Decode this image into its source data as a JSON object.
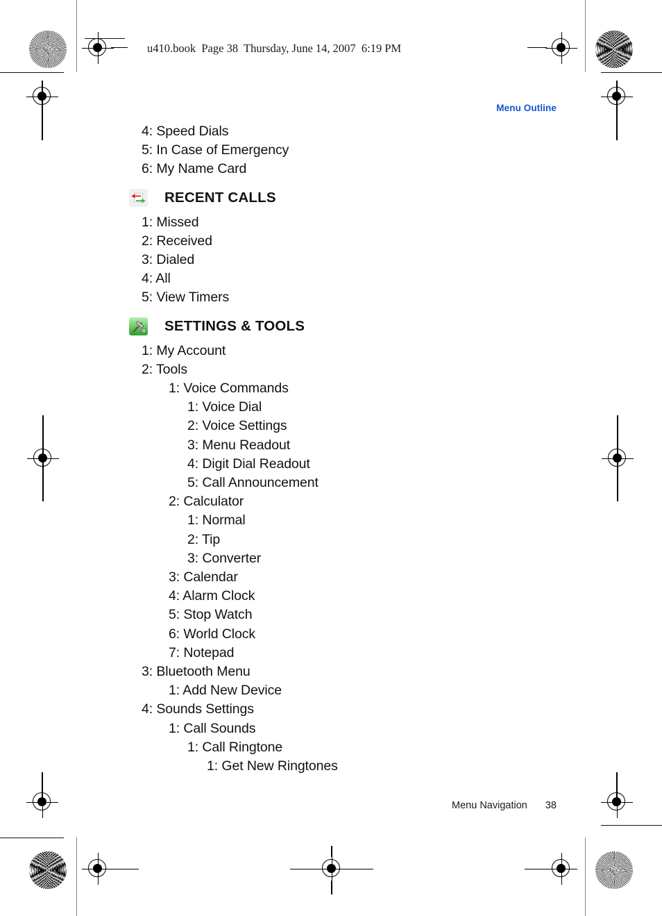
{
  "document": {
    "header_line": "u410.book  Page 38  Thursday, June 14, 2007  6:19 PM",
    "running_head": "Menu Outline",
    "running_head_color": "#1455d0",
    "footer_label": "Menu Navigation",
    "footer_page_number": "38"
  },
  "continued_items": [
    {
      "level": 1,
      "text": "4: Speed Dials"
    },
    {
      "level": 1,
      "text": "5: In Case of Emergency"
    },
    {
      "level": 1,
      "text": "6: My Name Card"
    }
  ],
  "sections": [
    {
      "title": "RECENT CALLS",
      "icon": "recent-calls-icon",
      "icon_colors": {
        "incoming_arrow": "#e02020",
        "outgoing_arrow": "#2eb82e",
        "background": "#e8ecef"
      },
      "items": [
        {
          "level": 1,
          "text": "1: Missed"
        },
        {
          "level": 1,
          "text": "2: Received"
        },
        {
          "level": 1,
          "text": "3: Dialed"
        },
        {
          "level": 1,
          "text": "4: All"
        },
        {
          "level": 1,
          "text": "5: View Timers"
        }
      ]
    },
    {
      "title": "SETTINGS & TOOLS",
      "icon": "settings-tools-icon",
      "icon_colors": {
        "background_top": "#8fe08a",
        "background_bottom": "#2f9e2a",
        "tool": "#4a4033"
      },
      "items": [
        {
          "level": 1,
          "text": "1: My Account"
        },
        {
          "level": 1,
          "text": "2: Tools"
        },
        {
          "level": 2,
          "text": "1: Voice Commands"
        },
        {
          "level": 3,
          "text": "1: Voice Dial"
        },
        {
          "level": 3,
          "text": "2: Voice Settings"
        },
        {
          "level": 3,
          "text": "3: Menu Readout"
        },
        {
          "level": 3,
          "text": "4: Digit Dial Readout"
        },
        {
          "level": 3,
          "text": "5: Call Announcement"
        },
        {
          "level": 2,
          "text": "2: Calculator"
        },
        {
          "level": 3,
          "text": "1: Normal"
        },
        {
          "level": 3,
          "text": "2: Tip"
        },
        {
          "level": 3,
          "text": "3: Converter"
        },
        {
          "level": 2,
          "text": "3: Calendar"
        },
        {
          "level": 2,
          "text": "4: Alarm Clock"
        },
        {
          "level": 2,
          "text": "5: Stop Watch"
        },
        {
          "level": 2,
          "text": "6: World Clock"
        },
        {
          "level": 2,
          "text": "7: Notepad"
        },
        {
          "level": 1,
          "text": "3: Bluetooth Menu"
        },
        {
          "level": 2,
          "text": "1: Add New Device"
        },
        {
          "level": 1,
          "text": "4: Sounds Settings"
        },
        {
          "level": 2,
          "text": "1: Call Sounds"
        },
        {
          "level": 3,
          "text": "1: Call Ringtone"
        },
        {
          "level": 4,
          "text": "1: Get New Ringtones"
        }
      ]
    }
  ]
}
